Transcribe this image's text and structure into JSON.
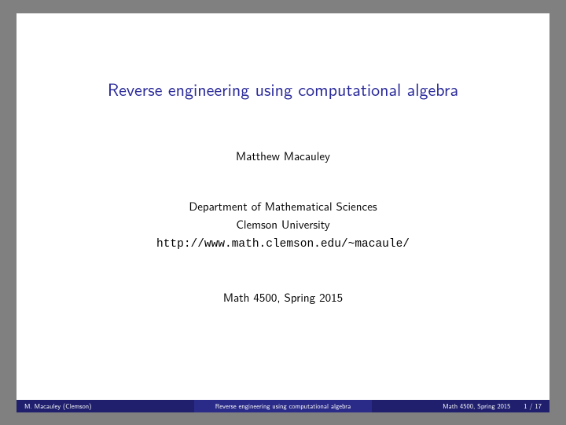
{
  "title": "Reverse engineering using computational algebra",
  "author": "Matthew Macauley",
  "department": "Department of Mathematical Sciences",
  "university": "Clemson University",
  "url": "http://www.math.clemson.edu/~macaule/",
  "course": "Math 4500, Spring 2015",
  "footer": {
    "author_short": "M. Macauley  (Clemson)",
    "title_short": "Reverse engineering using computational algebra",
    "course_short": "Math 4500, Spring 2015",
    "page": "1 / 17"
  }
}
